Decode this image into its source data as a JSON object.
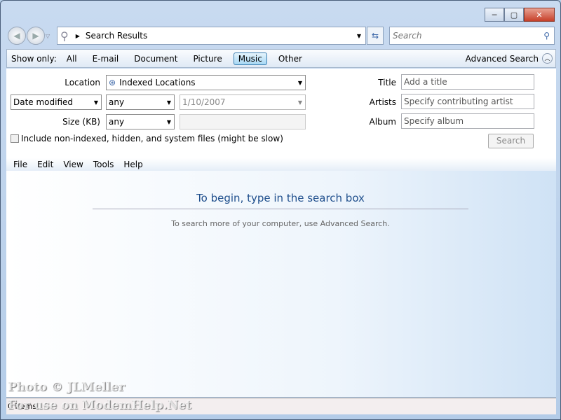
{
  "address": {
    "path": "Search Results",
    "search_placeholder": "Search"
  },
  "caption": {
    "minimize": "─",
    "maximize": "▢",
    "close": "✕"
  },
  "show_only": {
    "label": "Show only:",
    "items": [
      "All",
      "E-mail",
      "Document",
      "Picture",
      "Music",
      "Other"
    ],
    "selected": "Music",
    "advanced": "Advanced Search"
  },
  "pane": {
    "location_label": "Location",
    "location_value": "Indexed Locations",
    "date_field": "Date modified",
    "date_op": "any",
    "date_value": "1/10/2007",
    "size_label": "Size (KB)",
    "size_op": "any",
    "include_label": "Include non-indexed, hidden, and system files (might be slow)",
    "title_label": "Title",
    "title_placeholder": "Add a title",
    "artists_label": "Artists",
    "artists_placeholder": "Specify contributing artist",
    "album_label": "Album",
    "album_placeholder": "Specify album",
    "search_button": "Search"
  },
  "menu": [
    "File",
    "Edit",
    "View",
    "Tools",
    "Help"
  ],
  "content": {
    "heading": "To begin, type in the search box",
    "sub": "To search more of your computer, use Advanced Search."
  },
  "status": "0 items",
  "watermark": {
    "line1": "Photo © JLMeller",
    "line2": "For use on ModemHelp.Net"
  },
  "colors": {
    "accent": "#1e4e8c",
    "selected": "#a6d7f4"
  }
}
